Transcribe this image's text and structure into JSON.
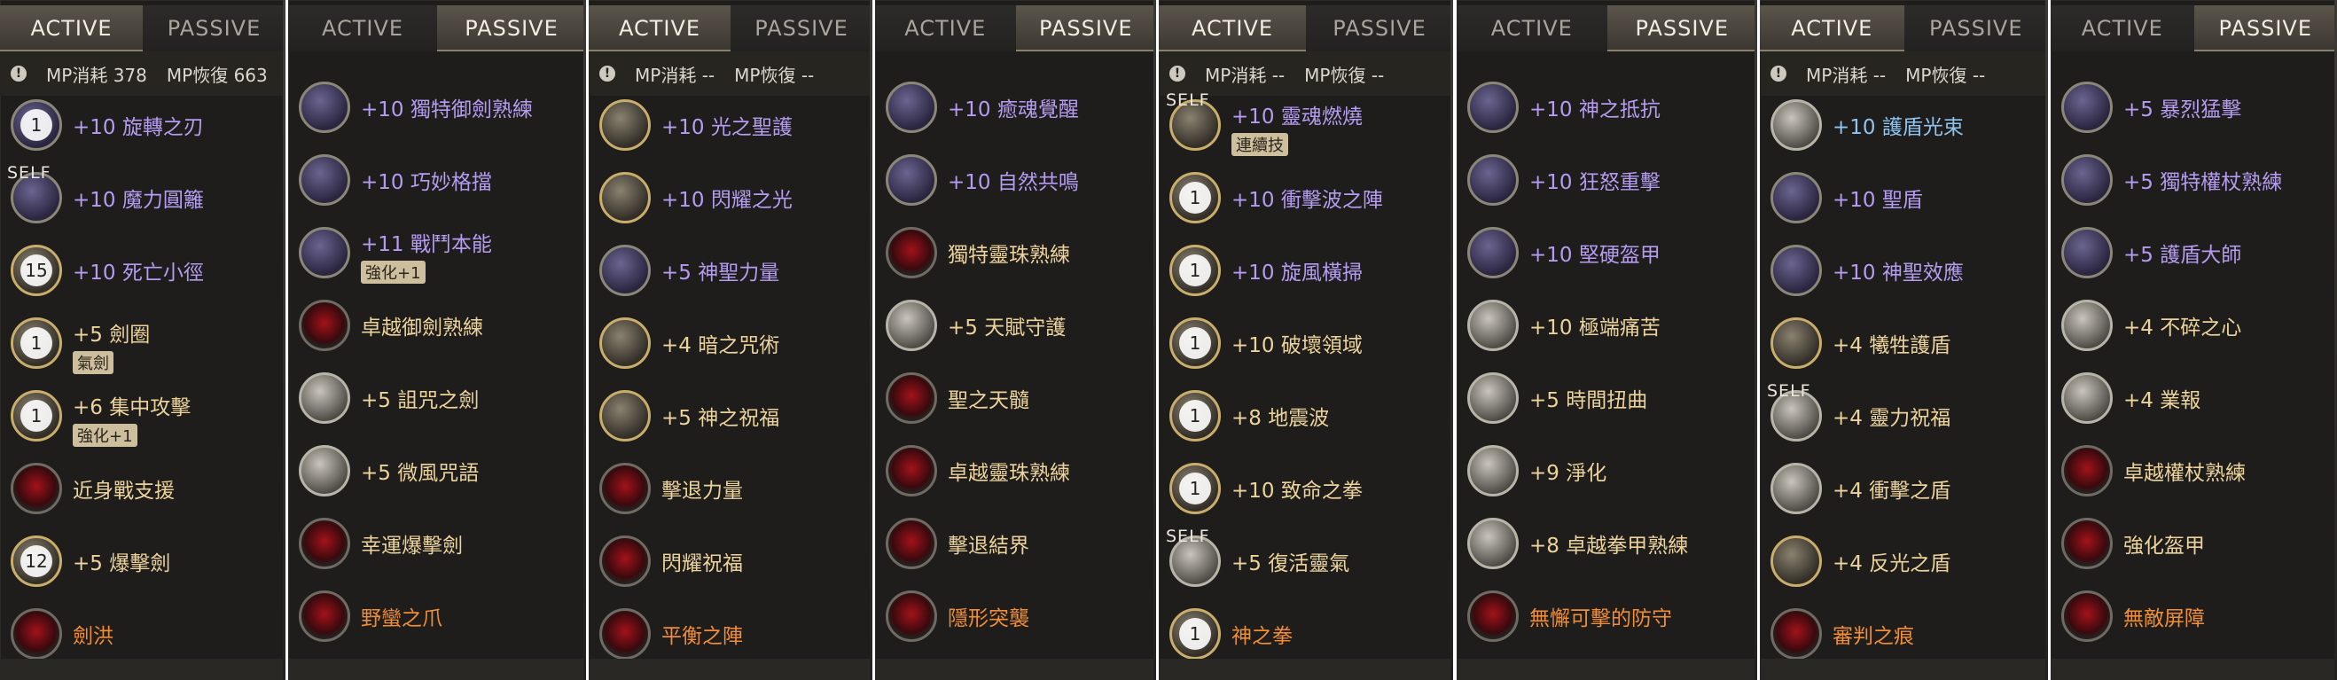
{
  "colors": {
    "purple": "#b59cf0",
    "tan": "#ecd39b",
    "orange": "#f08d37",
    "blue": "#8fc4f0"
  },
  "panels": [
    {
      "tabs": [
        "ACTIVE",
        "PASSIVE"
      ],
      "active_tab": 0,
      "mp": {
        "cost_label": "MP消耗",
        "cost_value": "378",
        "regen_label": "MP恢復",
        "regen_value": "663"
      },
      "rows": [
        {
          "icon": "sword-spin-icon",
          "style": "normal",
          "num": "1",
          "label": "+10 旋轉之刃",
          "color": "purple"
        },
        {
          "icon": "magic-circle-icon",
          "style": "normal",
          "self": "SELF",
          "label": "+10 魔力圓籬",
          "color": "purple"
        },
        {
          "icon": "death-path-icon",
          "style": "gold",
          "num": "15",
          "label": "+10 死亡小徑",
          "color": "purple"
        },
        {
          "icon": "sword-ring-icon",
          "style": "gold",
          "num": "1",
          "label": "+5 劍圈",
          "color": "tan",
          "badge": "氣劍"
        },
        {
          "icon": "focus-strike-icon",
          "style": "gold",
          "num": "1",
          "label": "+6 集中攻擊",
          "color": "tan",
          "badge": "強化+1"
        },
        {
          "icon": "melee-support-icon",
          "style": "red",
          "label": "近身戰支援",
          "color": "tan"
        },
        {
          "icon": "blast-sword-icon",
          "style": "gold",
          "num": "12",
          "label": "+5 爆擊劍",
          "color": "tan"
        },
        {
          "icon": "sword-flood-icon",
          "style": "red",
          "label": "劍洪",
          "color": "orange"
        }
      ]
    },
    {
      "tabs": [
        "ACTIVE",
        "PASSIVE"
      ],
      "active_tab": 1,
      "rows": [
        {
          "icon": "sword-mastery-icon",
          "style": "normal",
          "label": "+10 獨特御劍熟練",
          "color": "purple"
        },
        {
          "icon": "parry-icon",
          "style": "normal",
          "label": "+10 巧妙格擋",
          "color": "purple"
        },
        {
          "icon": "battle-instinct-icon",
          "style": "normal",
          "label": "+11 戰鬥本能",
          "color": "purple",
          "badge": "強化+1"
        },
        {
          "icon": "superior-sword-icon",
          "style": "red",
          "label": "卓越御劍熟練",
          "color": "tan"
        },
        {
          "icon": "cursed-sword-icon",
          "style": "white",
          "label": "+5 詛咒之劍",
          "color": "tan"
        },
        {
          "icon": "breeze-spell-icon",
          "style": "white",
          "label": "+5 微風咒語",
          "color": "tan"
        },
        {
          "icon": "lucky-blast-icon",
          "style": "red",
          "label": "幸運爆擊劍",
          "color": "tan"
        },
        {
          "icon": "savage-claw-icon",
          "style": "red",
          "label": "野蠻之爪",
          "color": "orange"
        }
      ]
    },
    {
      "tabs": [
        "ACTIVE",
        "PASSIVE"
      ],
      "active_tab": 0,
      "mp": {
        "cost_label": "MP消耗",
        "cost_value": "--",
        "regen_label": "MP恢復",
        "regen_value": "--"
      },
      "rows": [
        {
          "icon": "holy-shield-icon",
          "style": "gold",
          "label": "+10 光之聖護",
          "color": "purple"
        },
        {
          "icon": "radiant-light-icon",
          "style": "gold",
          "label": "+10 閃耀之光",
          "color": "purple"
        },
        {
          "icon": "divine-power-icon",
          "style": "normal",
          "label": "+5 神聖力量",
          "color": "purple"
        },
        {
          "icon": "dark-curse-icon",
          "style": "gold",
          "label": "+4 暗之咒術",
          "color": "tan"
        },
        {
          "icon": "god-blessing-icon",
          "style": "gold",
          "label": "+5 神之祝福",
          "color": "tan"
        },
        {
          "icon": "repel-power-icon",
          "style": "red",
          "label": "擊退力量",
          "color": "tan"
        },
        {
          "icon": "radiant-blessing-icon",
          "style": "red",
          "label": "閃耀祝福",
          "color": "tan"
        },
        {
          "icon": "balance-formation-icon",
          "style": "red",
          "label": "平衡之陣",
          "color": "orange"
        }
      ]
    },
    {
      "tabs": [
        "ACTIVE",
        "PASSIVE"
      ],
      "active_tab": 1,
      "rows": [
        {
          "icon": "soul-awaken-icon",
          "style": "normal",
          "label": "+10 癒魂覺醒",
          "color": "purple"
        },
        {
          "icon": "nature-resonance-icon",
          "style": "normal",
          "label": "+10 自然共鳴",
          "color": "purple"
        },
        {
          "icon": "spirit-orb-icon",
          "style": "red",
          "label": "獨特靈珠熟練",
          "color": "tan"
        },
        {
          "icon": "talent-guard-icon",
          "style": "white",
          "label": "+5 天賦守護",
          "color": "tan"
        },
        {
          "icon": "holy-marrow-icon",
          "style": "red",
          "label": "聖之天髓",
          "color": "tan"
        },
        {
          "icon": "superior-orb-icon",
          "style": "red",
          "label": "卓越靈珠熟練",
          "color": "tan"
        },
        {
          "icon": "repel-barrier-icon",
          "style": "red",
          "label": "擊退結界",
          "color": "tan"
        },
        {
          "icon": "stealth-assault-icon",
          "style": "red",
          "label": "隱形突襲",
          "color": "orange"
        }
      ]
    },
    {
      "tabs": [
        "ACTIVE",
        "PASSIVE"
      ],
      "active_tab": 0,
      "mp": {
        "cost_label": "MP消耗",
        "cost_value": "--",
        "regen_label": "MP恢復",
        "regen_value": "--"
      },
      "rows": [
        {
          "icon": "soul-burn-icon",
          "style": "gold",
          "self": "SELF",
          "label": "+10 靈魂燃燒",
          "color": "purple",
          "badge": "連續技"
        },
        {
          "icon": "shockwave-icon",
          "style": "gold",
          "num": "1",
          "label": "+10 衝擊波之陣",
          "color": "purple"
        },
        {
          "icon": "whirlwind-icon",
          "style": "gold",
          "num": "1",
          "label": "+10 旋風橫掃",
          "color": "purple"
        },
        {
          "icon": "destroy-field-icon",
          "style": "gold",
          "num": "1",
          "label": "+10 破壞領域",
          "color": "tan"
        },
        {
          "icon": "earthquake-icon",
          "style": "gold",
          "num": "1",
          "label": "+8 地震波",
          "color": "tan"
        },
        {
          "icon": "fatal-fist-icon",
          "style": "gold",
          "num": "1",
          "label": "+10 致命之拳",
          "color": "tan"
        },
        {
          "icon": "revive-aura-icon",
          "style": "white",
          "self": "SELF",
          "label": "+5 復活靈氣",
          "color": "tan"
        },
        {
          "icon": "god-fist-icon",
          "style": "gold",
          "num": "1",
          "label": "神之拳",
          "color": "orange"
        }
      ]
    },
    {
      "tabs": [
        "ACTIVE",
        "PASSIVE"
      ],
      "active_tab": 1,
      "rows": [
        {
          "icon": "god-resist-icon",
          "style": "normal",
          "label": "+10 神之抵抗",
          "color": "purple"
        },
        {
          "icon": "rage-strike-icon",
          "style": "normal",
          "label": "+10 狂怒重擊",
          "color": "purple"
        },
        {
          "icon": "hard-armor-icon",
          "style": "normal",
          "label": "+10 堅硬盔甲",
          "color": "purple"
        },
        {
          "icon": "extreme-pain-icon",
          "style": "white",
          "label": "+10 極端痛苦",
          "color": "tan"
        },
        {
          "icon": "time-twist-icon",
          "style": "white",
          "label": "+5 時間扭曲",
          "color": "tan"
        },
        {
          "icon": "purify-icon",
          "style": "white",
          "label": "+9 淨化",
          "color": "tan"
        },
        {
          "icon": "fist-armor-icon",
          "style": "white",
          "label": "+8 卓越拳甲熟練",
          "color": "tan"
        },
        {
          "icon": "invincible-guard-icon",
          "style": "red",
          "label": "無懈可擊的防守",
          "color": "orange"
        }
      ]
    },
    {
      "tabs": [
        "ACTIVE",
        "PASSIVE"
      ],
      "active_tab": 0,
      "mp": {
        "cost_label": "MP消耗",
        "cost_value": "--",
        "regen_label": "MP恢復",
        "regen_value": "--"
      },
      "rows": [
        {
          "icon": "shield-beam-icon",
          "style": "white",
          "label": "+10 護盾光束",
          "color": "blue"
        },
        {
          "icon": "holy-shield-icon",
          "style": "normal",
          "label": "+10 聖盾",
          "color": "purple"
        },
        {
          "icon": "divine-effect-icon",
          "style": "normal",
          "label": "+10 神聖效應",
          "color": "purple"
        },
        {
          "icon": "sacrifice-shield-icon",
          "style": "gold",
          "label": "+4 犧牲護盾",
          "color": "tan"
        },
        {
          "icon": "spirit-blessing-icon",
          "style": "white",
          "self": "SELF",
          "label": "+4 靈力祝福",
          "color": "tan"
        },
        {
          "icon": "impact-shield-icon",
          "style": "white",
          "label": "+4 衝擊之盾",
          "color": "tan"
        },
        {
          "icon": "reflect-shield-icon",
          "style": "gold",
          "label": "+4 反光之盾",
          "color": "tan"
        },
        {
          "icon": "judgment-mark-icon",
          "style": "red",
          "label": "審判之痕",
          "color": "orange"
        }
      ]
    },
    {
      "tabs": [
        "ACTIVE",
        "PASSIVE"
      ],
      "active_tab": 1,
      "rows": [
        {
          "icon": "fierce-strike-icon",
          "style": "normal",
          "label": "+5 暴烈猛擊",
          "color": "purple"
        },
        {
          "icon": "scepter-mastery-icon",
          "style": "normal",
          "label": "+5 獨特權杖熟練",
          "color": "purple"
        },
        {
          "icon": "shield-master-icon",
          "style": "normal",
          "label": "+5 護盾大師",
          "color": "purple"
        },
        {
          "icon": "unbreakable-heart-icon",
          "style": "white",
          "label": "+4 不碎之心",
          "color": "tan"
        },
        {
          "icon": "karma-icon",
          "style": "white",
          "label": "+4 業報",
          "color": "tan"
        },
        {
          "icon": "superior-scepter-icon",
          "style": "red",
          "label": "卓越權杖熟練",
          "color": "tan"
        },
        {
          "icon": "reinforced-armor-icon",
          "style": "red",
          "label": "強化盔甲",
          "color": "tan"
        },
        {
          "icon": "invincible-barrier-icon",
          "style": "red",
          "label": "無敵屏障",
          "color": "orange"
        }
      ]
    }
  ]
}
